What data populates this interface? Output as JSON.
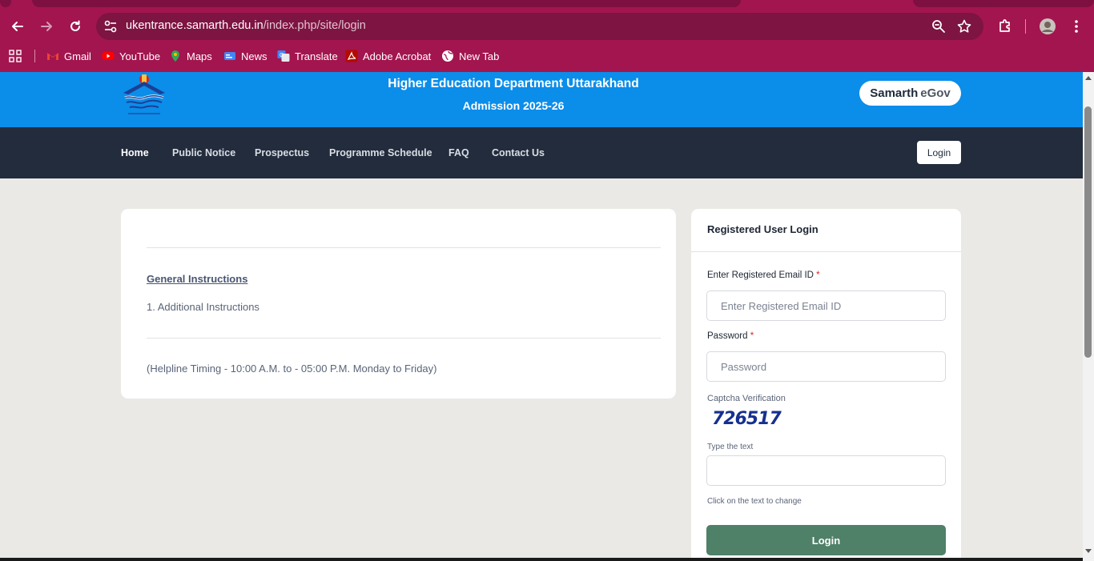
{
  "browser": {
    "url_host": "ukentrance.samarth.edu.in",
    "url_path": "/index.php/site/login",
    "bookmarks": [
      {
        "label": "Gmail",
        "icon": "gmail-icon"
      },
      {
        "label": "YouTube",
        "icon": "youtube-icon"
      },
      {
        "label": "Maps",
        "icon": "maps-icon"
      },
      {
        "label": "News",
        "icon": "news-icon"
      },
      {
        "label": "Translate",
        "icon": "translate-icon"
      },
      {
        "label": "Adobe Acrobat",
        "icon": "acrobat-icon"
      },
      {
        "label": "New Tab",
        "icon": "globe-icon"
      }
    ],
    "colors": {
      "chrome": "#a3154f",
      "omnibox": "#7d1442"
    }
  },
  "header": {
    "title": "Higher Education Department Uttarakhand",
    "subtitle": "Admission 2025-26",
    "brand_main": "Samarth",
    "brand_accent": "eGov",
    "color": "#0b8dea"
  },
  "nav": {
    "items": [
      "Home",
      "Public Notice",
      "Prospectus",
      "Programme Schedule",
      "FAQ",
      "Contact Us"
    ],
    "active": "Home",
    "login_label": "Login",
    "color": "#222c3c"
  },
  "instructions": {
    "heading": "General Instructions",
    "items": [
      "1. Additional Instructions"
    ],
    "helpline": "(Helpline Timing - 10:00 A.M. to - 05:00 P.M. Monday to Friday)"
  },
  "login": {
    "title": "Registered User Login",
    "email_label": "Enter Registered Email ID",
    "email_placeholder": "Enter Registered Email ID",
    "email_value": "",
    "password_label": "Password",
    "password_placeholder": "Password",
    "password_value": "",
    "required_mark": "*",
    "captcha_label": "Captcha Verification",
    "captcha_text": "726517",
    "captcha_input_label": "Type the text",
    "captcha_value": "",
    "captcha_hint": "Click on the text to change",
    "button_label": "Login",
    "button_color": "#4f8068"
  }
}
